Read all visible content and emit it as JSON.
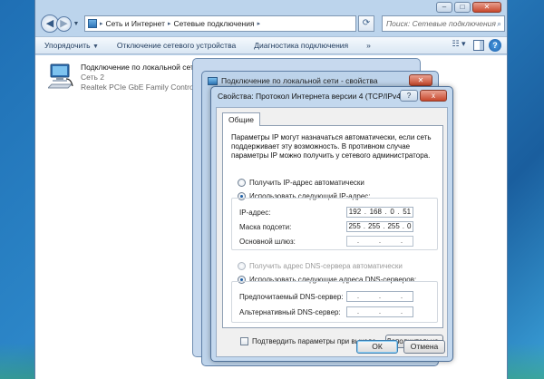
{
  "explorer": {
    "address": {
      "segments": [
        "Сеть и Интернет",
        "Сетевые подключения"
      ]
    },
    "search_placeholder": "Поиск: Сетевые подключения",
    "toolbar": {
      "organize": "Упорядочить",
      "disable_device": "Отключение сетевого устройства",
      "diagnose": "Диагностика подключения"
    },
    "connection": {
      "name": "Подключение по локальной сети",
      "network": "Сеть  2",
      "adapter": "Realtek PCIe GbE Family Controller"
    }
  },
  "back_window": {
    "title": "Подключение по локальной сети - свойства"
  },
  "dialog": {
    "title": "Свойства: Протокол Интернета версии 4 (TCP/IPv4)",
    "help_label": "?",
    "close_label": "x",
    "tab_general": "Общие",
    "intro": "Параметры IP могут назначаться автоматически, если сеть поддерживает эту возможность. В противном случае параметры IP можно получить у сетевого администратора.",
    "ip_auto": "Получить IP-адрес автоматически",
    "ip_manual": "Использовать следующий IP-адрес:",
    "ip_label": "IP-адрес:",
    "ip_value": [
      "192",
      "168",
      "0",
      "51"
    ],
    "mask_label": "Маска подсети:",
    "mask_value": [
      "255",
      "255",
      "255",
      "0"
    ],
    "gateway_label": "Основной шлюз:",
    "dns_auto": "Получить адрес DNS-сервера автоматически",
    "dns_manual": "Использовать следующие адреса DNS-серверов:",
    "dns_pref_label": "Предпочитаемый DNS-сервер:",
    "dns_alt_label": "Альтернативный DNS-сервер:",
    "confirm_on_exit": "Подтвердить параметры при выходе",
    "advanced_button": "Дополнительно...",
    "ok_button": "ОК",
    "cancel_button": "Отмена"
  }
}
